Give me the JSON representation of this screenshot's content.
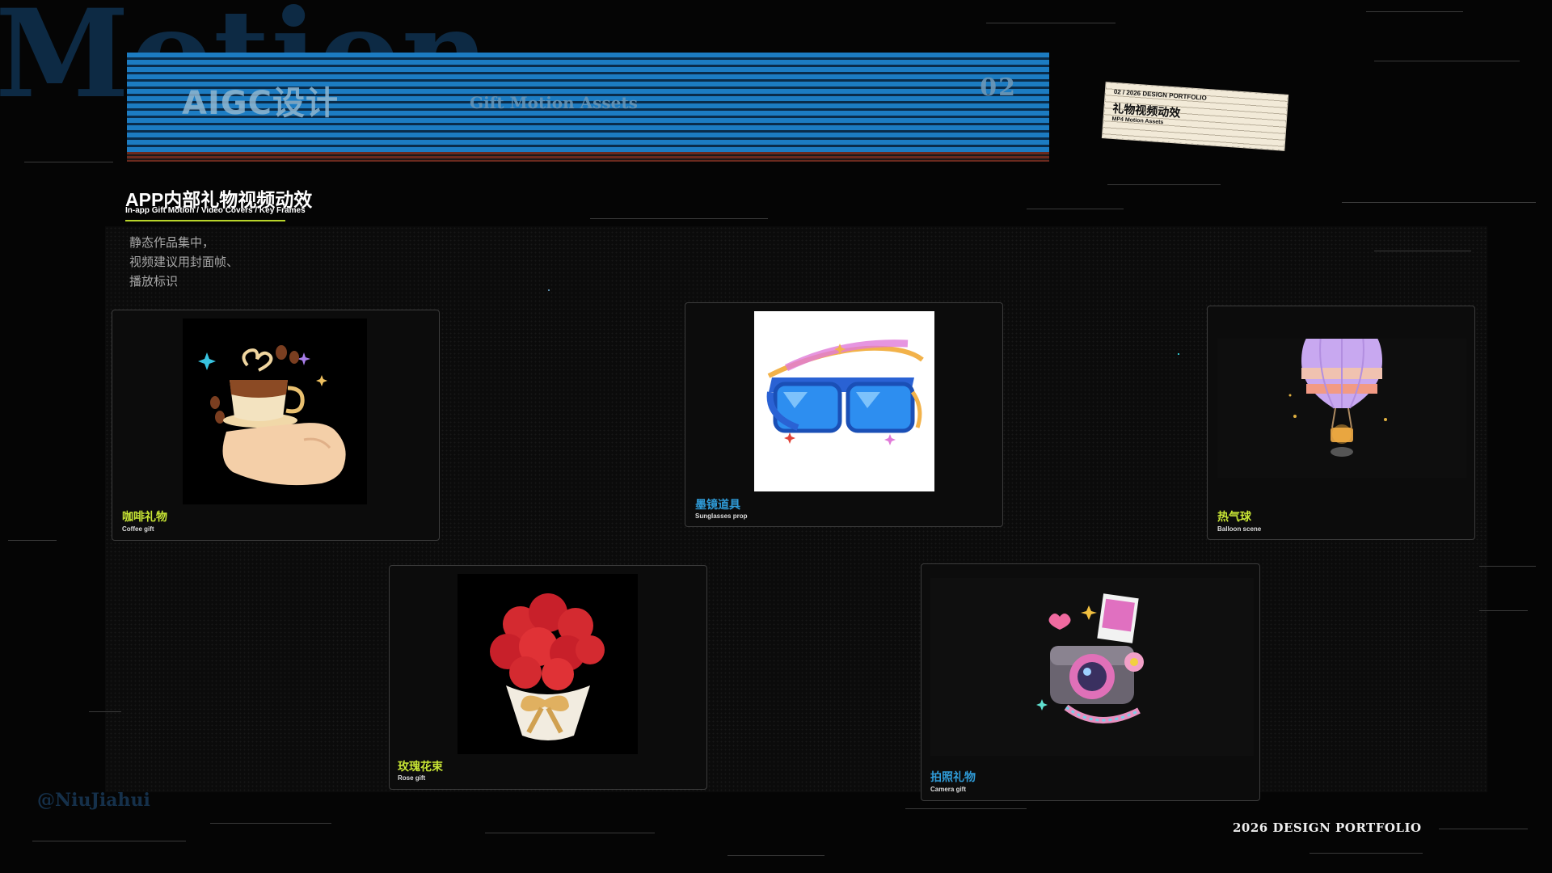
{
  "background": {
    "word": "Motion"
  },
  "banner": {
    "title": "AIGC设计",
    "subtitle": "Gift Motion Assets",
    "number": "02"
  },
  "ticket": {
    "top": "02 / 2026 DESIGN PORTFOLIO",
    "title": "礼物视频动效",
    "sub": "MP4 Motion Assets"
  },
  "section": {
    "title": "APP内部礼物视频动效",
    "subtitle": "In-app Gift Motion / Video Covers / Key Frames",
    "description": [
      "静态作品集中，",
      "视频建议用封面帧、",
      "播放标识"
    ]
  },
  "cards": [
    {
      "label": "咖啡礼物",
      "sublabel": "Coffee gift",
      "accent": "#c9e635",
      "icon": "coffee-hand-icon"
    },
    {
      "label": "墨镜道具",
      "sublabel": "Sunglasses prop",
      "accent": "#2f9ad6",
      "icon": "sunglasses-icon"
    },
    {
      "label": "热气球",
      "sublabel": "Balloon scene",
      "accent": "#c9e635",
      "icon": "hot-air-balloon-icon"
    },
    {
      "label": "玫瑰花束",
      "sublabel": "Rose gift",
      "accent": "#c9e635",
      "icon": "rose-bouquet-icon"
    },
    {
      "label": "拍照礼物",
      "sublabel": "Camera gift",
      "accent": "#2f9ad6",
      "icon": "camera-icon"
    }
  ],
  "watermark": "@NiuJiahui",
  "footer": "2026 DESIGN PORTFOLIO",
  "colors": {
    "background": "#050505",
    "banner_blue": "#1c7cc2",
    "accent_lime": "#c9e635",
    "accent_blue": "#2f9ad6",
    "ticket": "#f2ead8"
  }
}
